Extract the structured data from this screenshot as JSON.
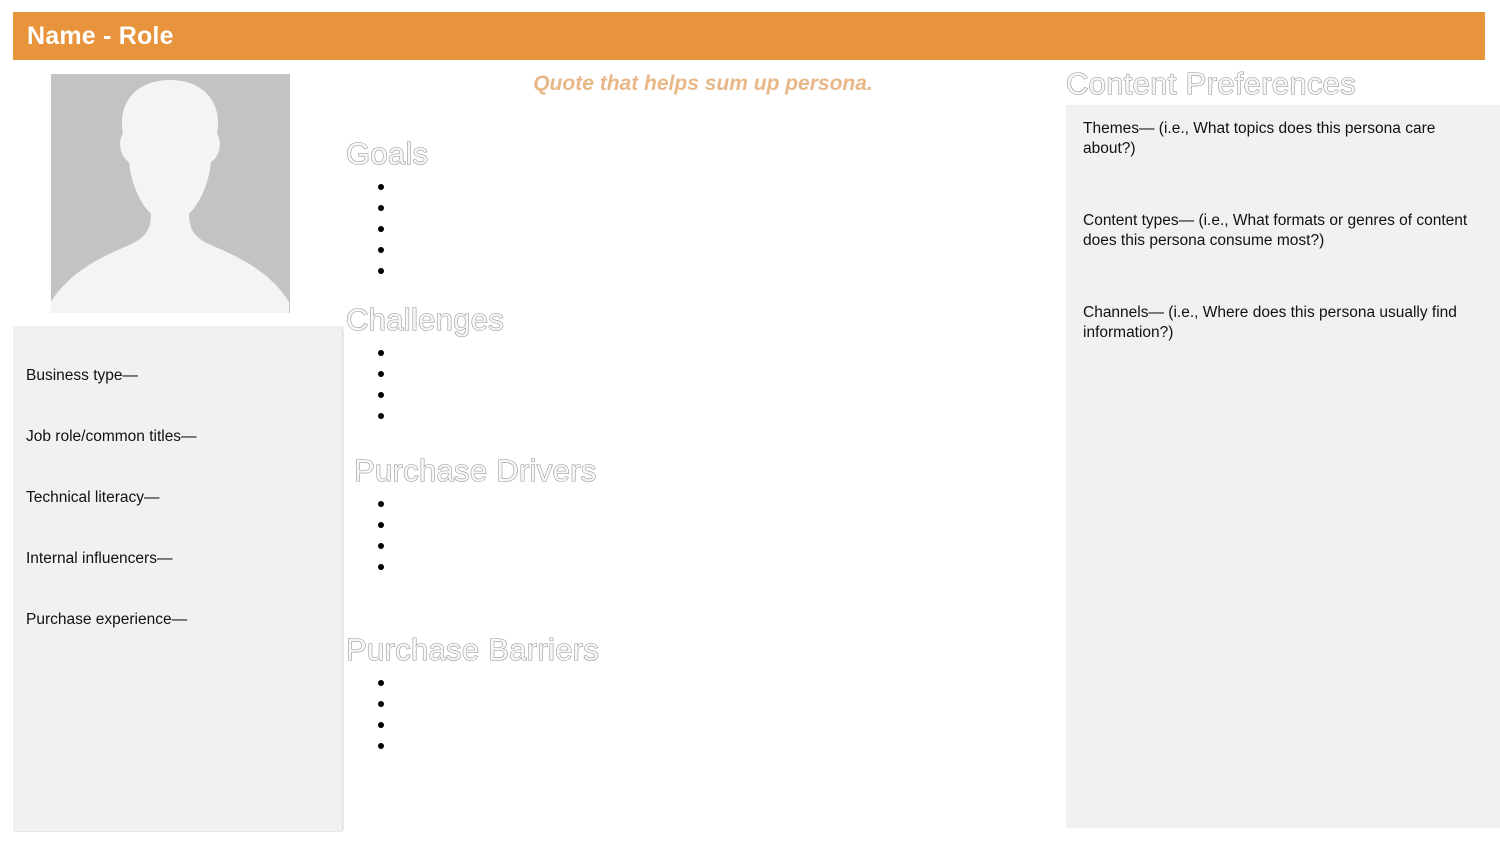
{
  "header": {
    "title": "Name - Role",
    "bar_color": "#e8943c",
    "title_color": "#ffffff"
  },
  "avatar": {
    "icon": "person-placeholder-icon",
    "background_color": "#f4f4f4",
    "silhouette_color": "#c3c3c3"
  },
  "sidebar": {
    "panel_color": "#f1f1f1",
    "fields": [
      {
        "label": "Business type—"
      },
      {
        "label": "Job role/common titles—"
      },
      {
        "label": "Technical literacy—"
      },
      {
        "label": "Internal influencers—"
      },
      {
        "label": "Purchase experience—"
      }
    ]
  },
  "center": {
    "quote": "Quote that helps sum up persona.",
    "quote_color": "#e8b888",
    "heading_outline_color": "#8f8f8f",
    "sections": [
      {
        "heading": "Goals",
        "bullet_count": 5
      },
      {
        "heading": "Challenges",
        "bullet_count": 4
      },
      {
        "heading": "Purchase Drivers",
        "bullet_count": 4
      },
      {
        "heading": "Purchase Barriers",
        "bullet_count": 4
      }
    ]
  },
  "content_preferences": {
    "heading": "Content Preferences",
    "panel_color": "#f1f1f1",
    "items": [
      {
        "text": "Themes— (i.e., What topics does this persona care about?)"
      },
      {
        "text": "Content types— (i.e., What formats or genres of content does this persona consume most?)"
      },
      {
        "text": "Channels— (i.e., Where does this persona usually find information?)"
      }
    ]
  }
}
